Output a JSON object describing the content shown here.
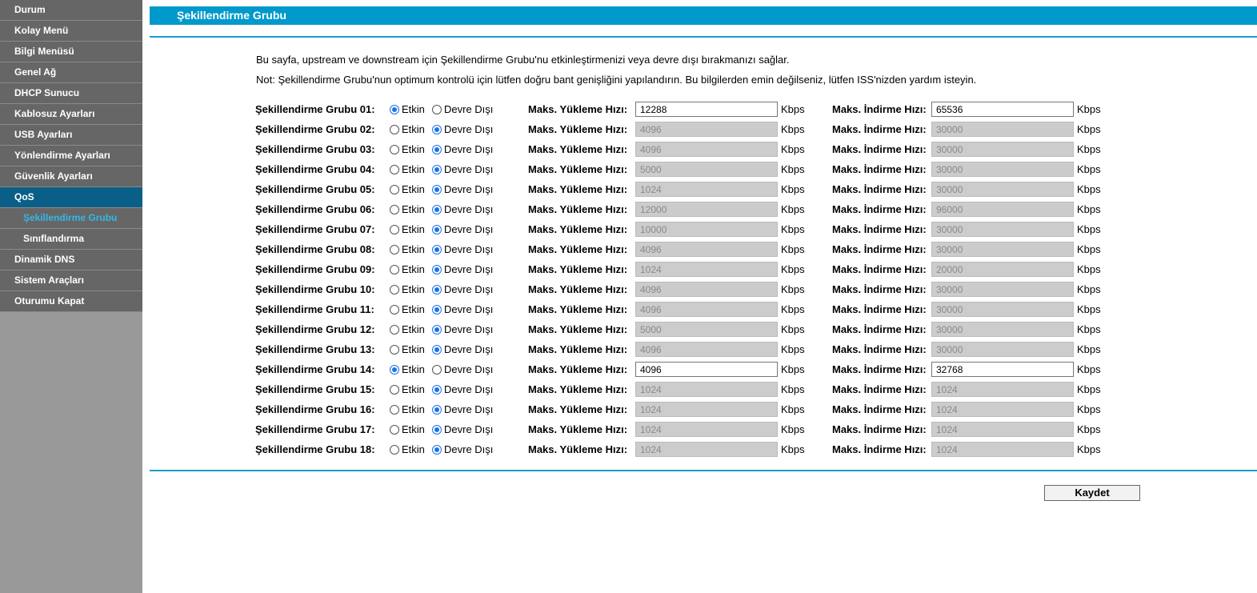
{
  "sidebar": {
    "items": [
      {
        "label": "Durum",
        "state": "normal"
      },
      {
        "label": "Kolay Menü",
        "state": "normal"
      },
      {
        "label": "Bilgi Menüsü",
        "state": "normal"
      },
      {
        "label": "Genel Ağ",
        "state": "normal"
      },
      {
        "label": "DHCP Sunucu",
        "state": "normal"
      },
      {
        "label": "Kablosuz Ayarları",
        "state": "normal"
      },
      {
        "label": "USB Ayarları",
        "state": "normal"
      },
      {
        "label": "Yönlendirme Ayarları",
        "state": "normal"
      },
      {
        "label": "Güvenlik Ayarları",
        "state": "normal"
      },
      {
        "label": "QoS",
        "state": "active"
      },
      {
        "label": "Şekillendirme Grubu",
        "state": "sub-selected"
      },
      {
        "label": "Sınıflandırma",
        "state": "sub"
      },
      {
        "label": "Dinamik DNS",
        "state": "normal"
      },
      {
        "label": "Sistem Araçları",
        "state": "normal"
      },
      {
        "label": "Oturumu Kapat",
        "state": "normal"
      }
    ]
  },
  "page": {
    "title": "Şekillendirme Grubu",
    "desc1": "Bu sayfa, upstream ve downstream için Şekillendirme Grubu'nu etkinleştirmenizi veya devre dışı bırakmanızı sağlar.",
    "desc2": "Not: Şekillendirme Grubu'nun optimum kontrolü için lütfen doğru bant genişliğini yapılandırın. Bu bilgilerden emin değilseniz, lütfen ISS'nizden yardım isteyin.",
    "save_label": "Kaydet"
  },
  "labels": {
    "enabled": "Etkin",
    "disabled": "Devre Dışı",
    "upload": "Maks. Yükleme Hızı:",
    "download": "Maks. İndirme Hızı:",
    "unit": "Kbps"
  },
  "groups": [
    {
      "name": "Şekillendirme Grubu 01:",
      "enabled": true,
      "upload": "12288",
      "download": "65536"
    },
    {
      "name": "Şekillendirme Grubu 02:",
      "enabled": false,
      "upload": "4096",
      "download": "30000"
    },
    {
      "name": "Şekillendirme Grubu 03:",
      "enabled": false,
      "upload": "4096",
      "download": "30000"
    },
    {
      "name": "Şekillendirme Grubu 04:",
      "enabled": false,
      "upload": "5000",
      "download": "30000"
    },
    {
      "name": "Şekillendirme Grubu 05:",
      "enabled": false,
      "upload": "1024",
      "download": "30000"
    },
    {
      "name": "Şekillendirme Grubu 06:",
      "enabled": false,
      "upload": "12000",
      "download": "96000"
    },
    {
      "name": "Şekillendirme Grubu 07:",
      "enabled": false,
      "upload": "10000",
      "download": "30000"
    },
    {
      "name": "Şekillendirme Grubu 08:",
      "enabled": false,
      "upload": "4096",
      "download": "30000"
    },
    {
      "name": "Şekillendirme Grubu 09:",
      "enabled": false,
      "upload": "1024",
      "download": "20000"
    },
    {
      "name": "Şekillendirme Grubu 10:",
      "enabled": false,
      "upload": "4096",
      "download": "30000"
    },
    {
      "name": "Şekillendirme Grubu 11:",
      "enabled": false,
      "upload": "4096",
      "download": "30000"
    },
    {
      "name": "Şekillendirme Grubu 12:",
      "enabled": false,
      "upload": "5000",
      "download": "30000"
    },
    {
      "name": "Şekillendirme Grubu 13:",
      "enabled": false,
      "upload": "4096",
      "download": "30000"
    },
    {
      "name": "Şekillendirme Grubu 14:",
      "enabled": true,
      "upload": "4096",
      "download": "32768"
    },
    {
      "name": "Şekillendirme Grubu 15:",
      "enabled": false,
      "upload": "1024",
      "download": "1024"
    },
    {
      "name": "Şekillendirme Grubu 16:",
      "enabled": false,
      "upload": "1024",
      "download": "1024"
    },
    {
      "name": "Şekillendirme Grubu 17:",
      "enabled": false,
      "upload": "1024",
      "download": "1024"
    },
    {
      "name": "Şekillendirme Grubu 18:",
      "enabled": false,
      "upload": "1024",
      "download": "1024"
    }
  ],
  "colors": {
    "accent": "#0099cc",
    "sidebar_bg": "#999999",
    "menu_bg": "#666666",
    "menu_active": "#0a5f88",
    "submenu_selected_text": "#31b8e8",
    "radio_on": "#1a73e8",
    "disabled_input_bg": "#cccccc"
  }
}
